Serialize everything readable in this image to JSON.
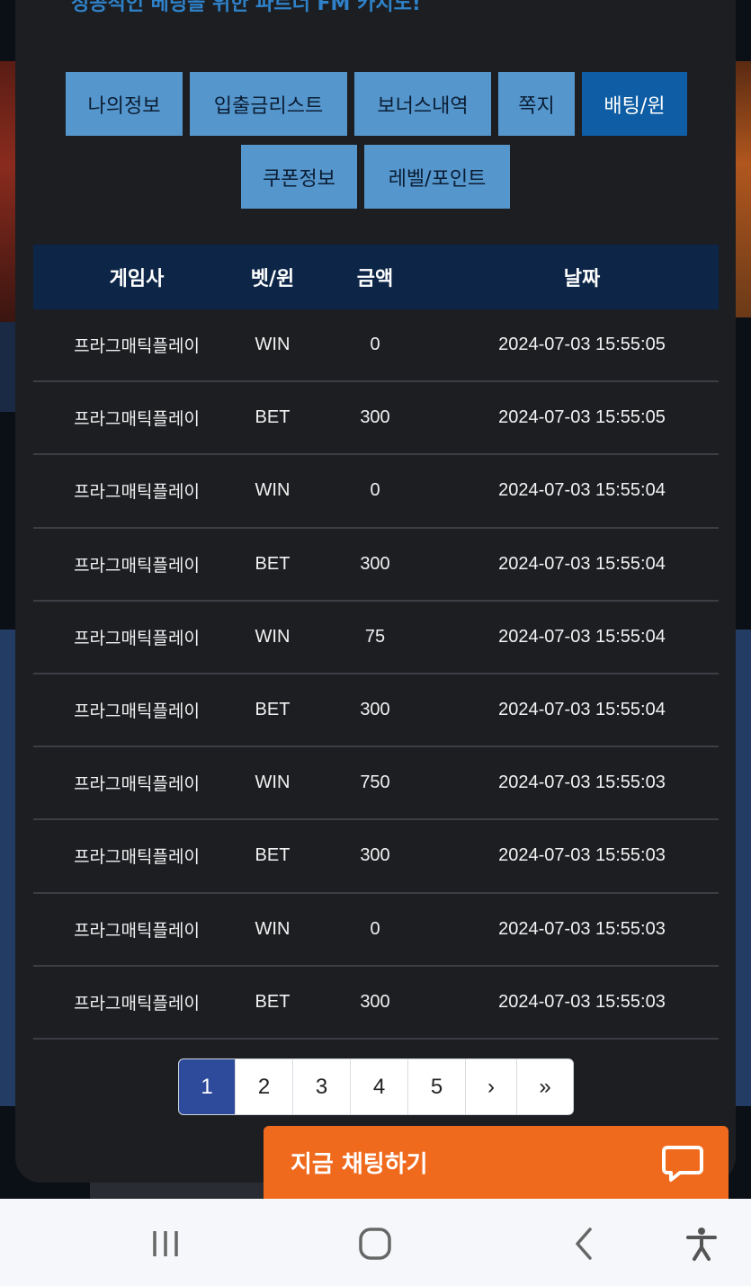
{
  "promo_text": "성공적인 베팅을 위한 파트너 FM 카지노!",
  "tabs_row1": [
    {
      "label": "나의정보",
      "active": false
    },
    {
      "label": "입출금리스트",
      "active": false
    },
    {
      "label": "보너스내역",
      "active": false
    },
    {
      "label": "쪽지",
      "active": false
    },
    {
      "label": "배팅/윈",
      "active": true
    }
  ],
  "tabs_row2": [
    {
      "label": "쿠폰정보",
      "active": false
    },
    {
      "label": "레벨/포인트",
      "active": false
    }
  ],
  "table": {
    "headers": [
      "게임사",
      "벳/윈",
      "금액",
      "날짜"
    ],
    "rows": [
      [
        "프라그매틱플레이",
        "WIN",
        "0",
        "2024-07-03 15:55:05"
      ],
      [
        "프라그매틱플레이",
        "BET",
        "300",
        "2024-07-03 15:55:05"
      ],
      [
        "프라그매틱플레이",
        "WIN",
        "0",
        "2024-07-03 15:55:04"
      ],
      [
        "프라그매틱플레이",
        "BET",
        "300",
        "2024-07-03 15:55:04"
      ],
      [
        "프라그매틱플레이",
        "WIN",
        "75",
        "2024-07-03 15:55:04"
      ],
      [
        "프라그매틱플레이",
        "BET",
        "300",
        "2024-07-03 15:55:04"
      ],
      [
        "프라그매틱플레이",
        "WIN",
        "750",
        "2024-07-03 15:55:03"
      ],
      [
        "프라그매틱플레이",
        "BET",
        "300",
        "2024-07-03 15:55:03"
      ],
      [
        "프라그매틱플레이",
        "WIN",
        "0",
        "2024-07-03 15:55:03"
      ],
      [
        "프라그매틱플레이",
        "BET",
        "300",
        "2024-07-03 15:55:03"
      ]
    ]
  },
  "pagination": {
    "pages": [
      "1",
      "2",
      "3",
      "4",
      "5"
    ],
    "current": "1",
    "next": "›",
    "last": "»"
  },
  "chat": {
    "label": "지금 채팅하기",
    "icon": "chat-bubble-icon"
  },
  "navbar": {
    "icons": [
      "recent-apps-icon",
      "home-icon",
      "back-icon",
      "accessibility-icon"
    ]
  },
  "colors": {
    "tab": "#5596cd",
    "tab_active": "#0f5ea5",
    "header": "#0d2647",
    "chat": "#f06a1e",
    "page_active": "#2e4a9a"
  }
}
